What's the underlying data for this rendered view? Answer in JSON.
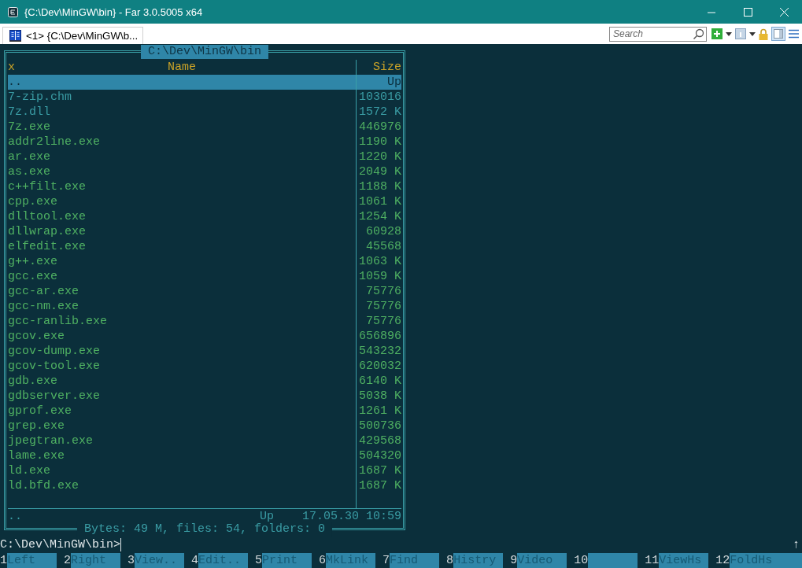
{
  "window": {
    "title": "{C:\\Dev\\MinGW\\bin} - Far 3.0.5005 x64"
  },
  "tabs": [
    {
      "label": "<1> {C:\\Dev\\MinGW\\b...",
      "selected": true
    }
  ],
  "search": {
    "placeholder": "Search"
  },
  "panel": {
    "path": "C:\\Dev\\MinGW\\bin",
    "sort_mark": "x",
    "name_heading": "Name",
    "size_heading": "Size",
    "rows": [
      {
        "name": "..",
        "size": "Up",
        "selected": true
      },
      {
        "name": "7-zip.chm",
        "size": "103016",
        "selected": false,
        "color": "#3a9ca4"
      },
      {
        "name": "7z.dll",
        "size": "1572 K",
        "selected": false,
        "color": "#3a9ca4"
      },
      {
        "name": "7z.exe",
        "size": "446976",
        "selected": false,
        "color": "#4fb062"
      },
      {
        "name": "addr2line.exe",
        "size": "1190 K",
        "selected": false,
        "color": "#4fb062"
      },
      {
        "name": "ar.exe",
        "size": "1220 K",
        "selected": false,
        "color": "#4fb062"
      },
      {
        "name": "as.exe",
        "size": "2049 K",
        "selected": false,
        "color": "#4fb062"
      },
      {
        "name": "c++filt.exe",
        "size": "1188 K",
        "selected": false,
        "color": "#4fb062"
      },
      {
        "name": "cpp.exe",
        "size": "1061 K",
        "selected": false,
        "color": "#4fb062"
      },
      {
        "name": "dlltool.exe",
        "size": "1254 K",
        "selected": false,
        "color": "#4fb062"
      },
      {
        "name": "dllwrap.exe",
        "size": "60928",
        "selected": false,
        "color": "#4fb062"
      },
      {
        "name": "elfedit.exe",
        "size": "45568",
        "selected": false,
        "color": "#4fb062"
      },
      {
        "name": "g++.exe",
        "size": "1063 K",
        "selected": false,
        "color": "#4fb062"
      },
      {
        "name": "gcc.exe",
        "size": "1059 K",
        "selected": false,
        "color": "#4fb062"
      },
      {
        "name": "gcc-ar.exe",
        "size": "75776",
        "selected": false,
        "color": "#4fb062"
      },
      {
        "name": "gcc-nm.exe",
        "size": "75776",
        "selected": false,
        "color": "#4fb062"
      },
      {
        "name": "gcc-ranlib.exe",
        "size": "75776",
        "selected": false,
        "color": "#4fb062"
      },
      {
        "name": "gcov.exe",
        "size": "656896",
        "selected": false,
        "color": "#4fb062"
      },
      {
        "name": "gcov-dump.exe",
        "size": "543232",
        "selected": false,
        "color": "#4fb062"
      },
      {
        "name": "gcov-tool.exe",
        "size": "620032",
        "selected": false,
        "color": "#4fb062"
      },
      {
        "name": "gdb.exe",
        "size": "6140 K",
        "selected": false,
        "color": "#4fb062"
      },
      {
        "name": "gdbserver.exe",
        "size": "5038 K",
        "selected": false,
        "color": "#4fb062"
      },
      {
        "name": "gprof.exe",
        "size": "1261 K",
        "selected": false,
        "color": "#4fb062"
      },
      {
        "name": "grep.exe",
        "size": "500736",
        "selected": false,
        "color": "#4fb062"
      },
      {
        "name": "jpegtran.exe",
        "size": "429568",
        "selected": false,
        "color": "#4fb062"
      },
      {
        "name": "lame.exe",
        "size": "504320",
        "selected": false,
        "color": "#4fb062"
      },
      {
        "name": "ld.exe",
        "size": "1687 K",
        "selected": false,
        "color": "#4fb062"
      },
      {
        "name": "ld.bfd.exe",
        "size": "1687 K",
        "selected": false,
        "color": "#4fb062"
      }
    ],
    "status": {
      "name": "..",
      "size": "Up",
      "date": "17.05.30",
      "time": "10:59"
    },
    "summary": "Bytes: 49 M, files: 54, folders: 0"
  },
  "command_line": {
    "prompt": "C:\\Dev\\MinGW\\bin>",
    "scroll_mark": "↑"
  },
  "keybar": [
    {
      "key": "1",
      "label": "Left"
    },
    {
      "key": "2",
      "label": "Right"
    },
    {
      "key": "3",
      "label": "View.."
    },
    {
      "key": "4",
      "label": "Edit.."
    },
    {
      "key": "5",
      "label": "Print"
    },
    {
      "key": "6",
      "label": "MkLink"
    },
    {
      "key": "7",
      "label": "Find"
    },
    {
      "key": "8",
      "label": "Histry"
    },
    {
      "key": "9",
      "label": "Video"
    },
    {
      "key": "10"
    },
    {
      "key": "11",
      "label": "ViewHs"
    },
    {
      "key": "12",
      "label": "FoldHs"
    }
  ]
}
